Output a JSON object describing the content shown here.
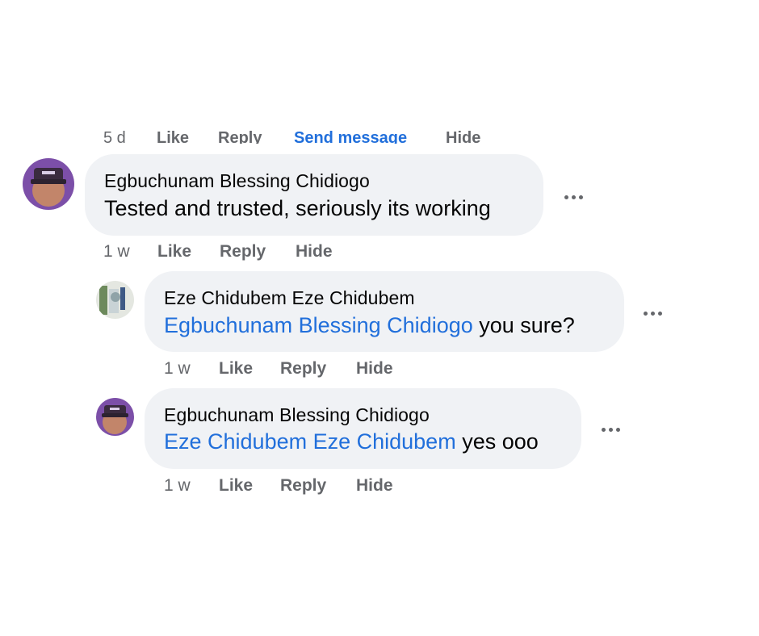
{
  "previous_comment_actions": {
    "time": "5 d",
    "like": "Like",
    "reply": "Reply",
    "send_message": "Send message",
    "hide": "Hide"
  },
  "comments": [
    {
      "author": "Egbuchunam Blessing Chidiogo",
      "mention": "",
      "text": "Tested and trusted, seriously its working",
      "time": "1 w",
      "like": "Like",
      "reply": "Reply",
      "hide": "Hide"
    },
    {
      "author": "Eze Chidubem Eze Chidubem",
      "mention": "Egbuchunam Blessing Chidiogo",
      "text": " you sure?",
      "time": "1 w",
      "like": "Like",
      "reply": "Reply",
      "hide": "Hide"
    },
    {
      "author": "Egbuchunam Blessing Chidiogo",
      "mention": "Eze Chidubem Eze Chidubem",
      "text": " yes ooo",
      "time": "1 w",
      "like": "Like",
      "reply": "Reply",
      "hide": "Hide"
    }
  ],
  "colors": {
    "bubble": "#f0f2f5",
    "mention": "#216fdb",
    "meta": "#65676b",
    "text": "#050505"
  }
}
